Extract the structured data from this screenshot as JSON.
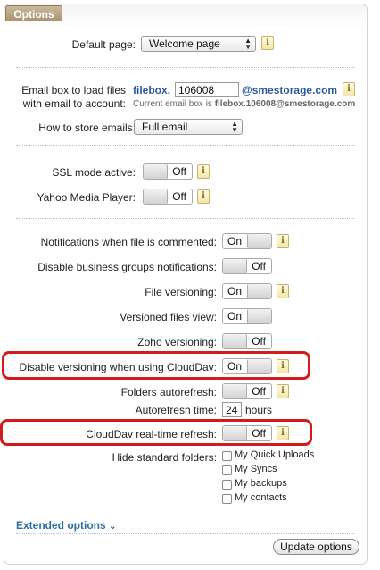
{
  "tab": {
    "title": "Options"
  },
  "default_page": {
    "label": "Default page:",
    "value": "Welcome page"
  },
  "email_box": {
    "label_line1": "Email box to load files",
    "label_line2": "with email to account:",
    "prefix": "filebox.",
    "value": "106008",
    "domain": "@smestorage.com",
    "hint_prefix": "Current email box is ",
    "hint_value": "filebox.106008@smestorage.com"
  },
  "store_emails": {
    "label": "How to store emails:",
    "value": "Full email"
  },
  "ssl_mode": {
    "label": "SSL mode active:",
    "state": "Off"
  },
  "yahoo_player": {
    "label": "Yahoo Media Player:",
    "state": "Off"
  },
  "notifications_commented": {
    "label": "Notifications when file is commented:",
    "state": "On"
  },
  "disable_business": {
    "label": "Disable business groups notifications:",
    "state": "Off"
  },
  "file_versioning": {
    "label": "File versioning:",
    "state": "On"
  },
  "versioned_view": {
    "label": "Versioned files view:",
    "state": "On"
  },
  "zoho_versioning": {
    "label": "Zoho versioning:",
    "state": "Off"
  },
  "cloudav_versioning": {
    "label": "Disable versioning when using CloudDav:",
    "state": "On"
  },
  "folders_autorefresh": {
    "label": "Folders autorefresh:",
    "state": "Off"
  },
  "autorefresh_time": {
    "label": "Autorefresh time:",
    "value": "24",
    "unit": "hours"
  },
  "cloudav_realtime": {
    "label": "CloudDav real-time refresh:",
    "state": "Off"
  },
  "hide_folders": {
    "label": "Hide standard folders:",
    "options": [
      "My Quick Uploads",
      "My Syncs",
      "My backups",
      "My contacts"
    ]
  },
  "extended_options": {
    "label": "Extended options",
    "chevron": "⌄"
  },
  "update_button": {
    "label": "Update options"
  },
  "info_glyph": "i",
  "colors": {
    "highlight": "#d21c1c",
    "link": "#2a6fa0",
    "tab": "#a99570"
  }
}
